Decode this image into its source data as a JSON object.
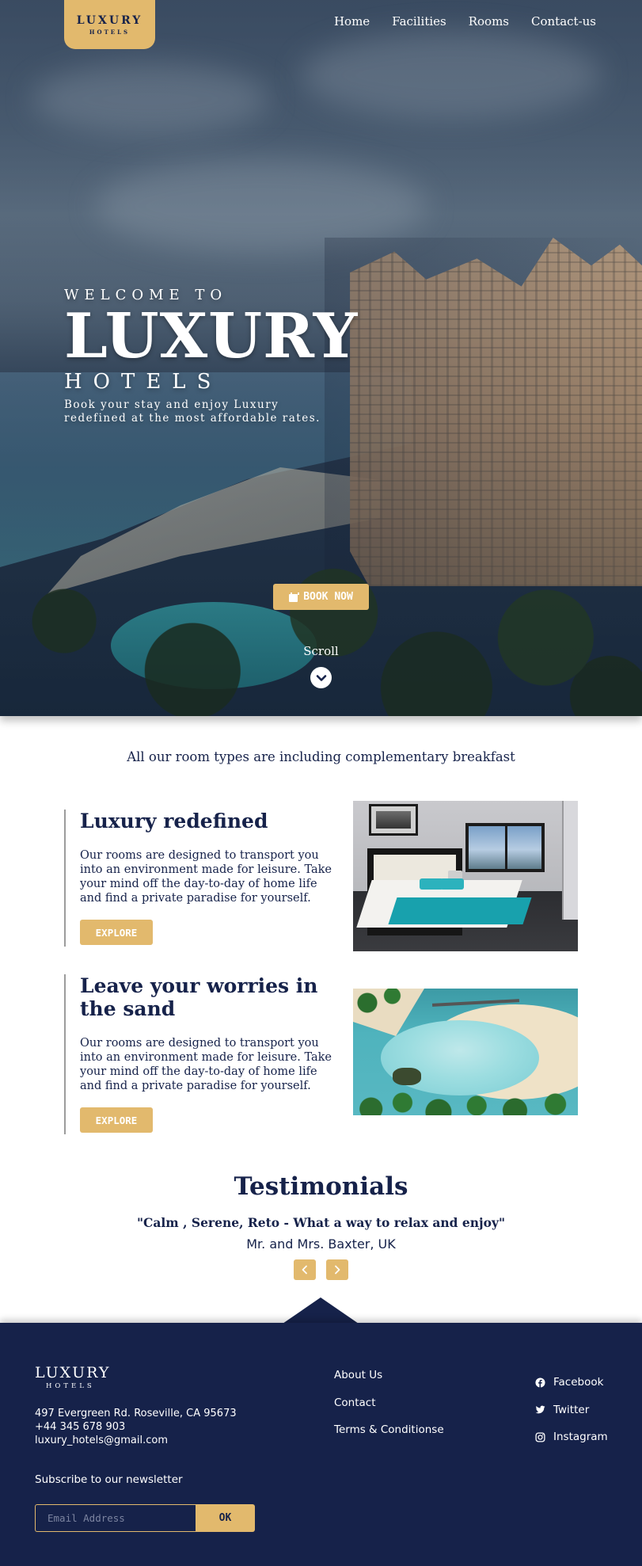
{
  "brand": {
    "name": "LUXURY",
    "sub": "HOTELS"
  },
  "nav": [
    {
      "label": "Home"
    },
    {
      "label": "Facilities"
    },
    {
      "label": "Rooms"
    },
    {
      "label": "Contact-us"
    }
  ],
  "hero": {
    "welcome": "WELCOME TO",
    "title": "LUXURY",
    "subtitle": "HOTELS",
    "tagline": "Book your stay and enjoy Luxury redefined at the most affordable rates.",
    "book_label": "BOOK NOW",
    "book_icon": "calendar-icon",
    "scroll_label": "Scroll",
    "scroll_icon": "chevron-down-icon"
  },
  "intro": "All our room types are including complementary breakfast",
  "features": [
    {
      "title": "Luxury redefined",
      "text": "Our rooms are designed to transport you into an environment made for leisure. Take your mind off the day-to-day of home life and find a private paradise for yourself.",
      "button": "EXPLORE"
    },
    {
      "title": "Leave your worries in the sand",
      "text": "Our rooms are designed to transport you into an environment made for leisure. Take your mind off the day-to-day of home life and find a private paradise for yourself.",
      "button": "EXPLORE"
    }
  ],
  "testimonials": {
    "title": "Testimonials",
    "quote": "\"Calm , Serene, Reto - What a way to relax and enjoy\"",
    "author": "Mr. and Mrs. Baxter, UK"
  },
  "footer": {
    "logo_main": "LUXURY",
    "logo_sub": "HOTELS",
    "address": "497 Evergreen Rd. Roseville, CA 95673",
    "phone": "+44 345 678 903",
    "email": "luxury_hotels@gmail.com",
    "links": [
      "About Us",
      "Contact",
      "Terms & Conditionse"
    ],
    "social": [
      {
        "label": "Facebook",
        "icon": "facebook-icon"
      },
      {
        "label": "Twitter",
        "icon": "twitter-icon"
      },
      {
        "label": "Instagram",
        "icon": "instagram-icon"
      }
    ],
    "subscribe_label": "Subscribe to our newsletter",
    "email_placeholder": "Email Address",
    "ok_label": "OK"
  },
  "colors": {
    "navy": "#16224a",
    "gold": "#e2b96d",
    "white": "#ffffff"
  }
}
